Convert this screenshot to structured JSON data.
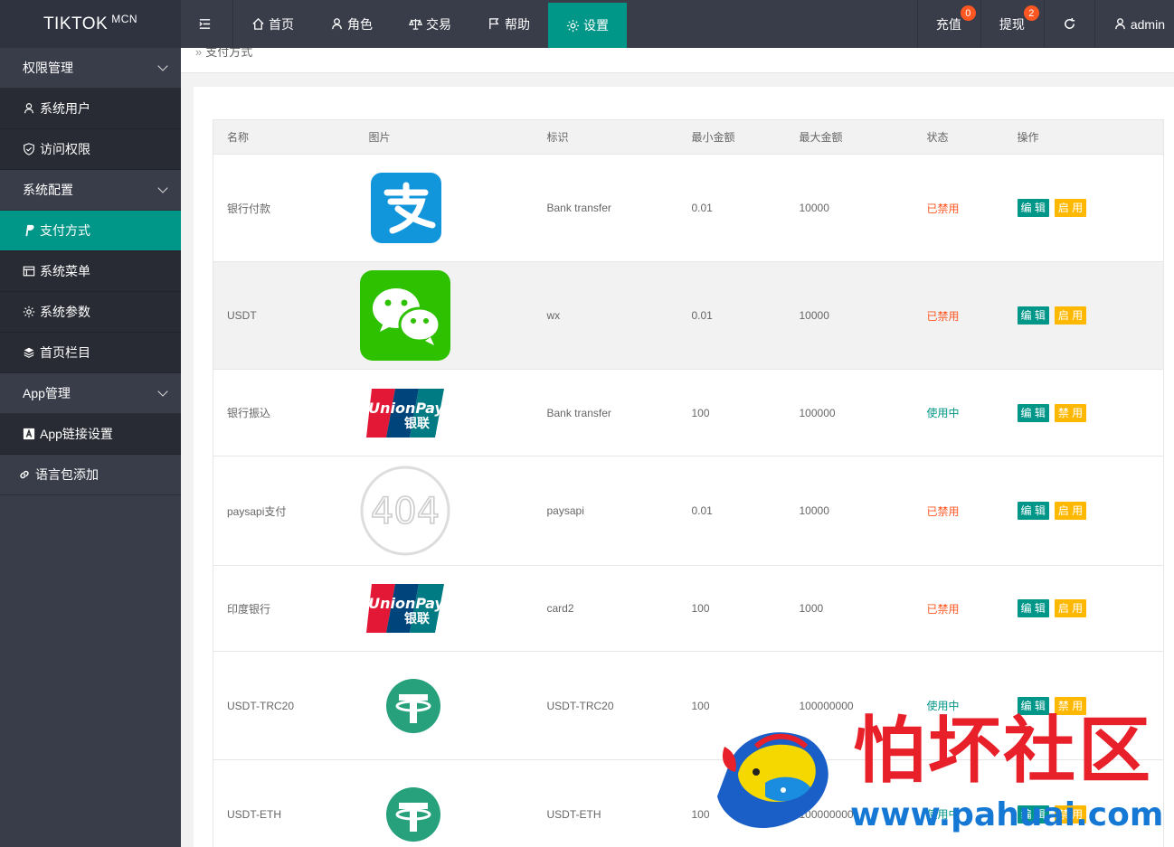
{
  "app": {
    "logo_main": "TIKTOK",
    "logo_sup": "MCN"
  },
  "header": {
    "nav": [
      {
        "label": "首页",
        "icon": "home-icon"
      },
      {
        "label": "角色",
        "icon": "user-icon"
      },
      {
        "label": "交易",
        "icon": "scale-icon"
      },
      {
        "label": "帮助",
        "icon": "flag-icon"
      },
      {
        "label": "设置",
        "icon": "gear-icon",
        "active": true
      }
    ],
    "recharge_label": "充值",
    "recharge_badge": "0",
    "withdraw_label": "提现",
    "withdraw_badge": "2",
    "admin_label": "admin"
  },
  "sidebar": {
    "group1": "权限管理",
    "item_users": "系统用户",
    "item_access": "访问权限",
    "group2": "系统配置",
    "item_payment": "支付方式",
    "item_menu": "系统菜单",
    "item_params": "系统参数",
    "item_home_columns": "首页栏目",
    "group3": "App管理",
    "item_app_link": "App链接设置",
    "item_lang": "语言包添加"
  },
  "breadcrumb": {
    "current": "支付方式"
  },
  "table": {
    "headers": {
      "name": "名称",
      "image": "图片",
      "id": "标识",
      "min": "最小金额",
      "max": "最大金额",
      "status": "状态",
      "action": "操作"
    },
    "edit_label": "编 辑",
    "rows": [
      {
        "name": "银行付款",
        "icon": "alipay-icon",
        "id": "Bank transfer",
        "min": "0.01",
        "max": "10000",
        "status": "已禁用",
        "toggle": "启 用"
      },
      {
        "name": "USDT",
        "icon": "wechat-icon",
        "id": "wx",
        "min": "0.01",
        "max": "10000",
        "status": "已禁用",
        "toggle": "启 用"
      },
      {
        "name": "银行振込",
        "icon": "unionpay-icon",
        "id": "Bank transfer",
        "min": "100",
        "max": "100000",
        "status": "使用中",
        "toggle": "禁 用"
      },
      {
        "name": "paysapi支付",
        "icon": "404-placeholder-icon",
        "id": "paysapi",
        "min": "0.01",
        "max": "10000",
        "status": "已禁用",
        "toggle": "启 用"
      },
      {
        "name": "印度银行",
        "icon": "unionpay-icon",
        "id": "card2",
        "min": "100",
        "max": "1000",
        "status": "已禁用",
        "toggle": "启 用"
      },
      {
        "name": "USDT-TRC20",
        "icon": "tether-icon",
        "id": "USDT-TRC20",
        "min": "100",
        "max": "100000000",
        "status": "使用中",
        "toggle": "禁 用"
      },
      {
        "name": "USDT-ETH",
        "icon": "tether-icon",
        "id": "USDT-ETH",
        "min": "100",
        "max": "100000000",
        "status": "使用中",
        "toggle": "禁 用"
      }
    ],
    "icon_text": {
      "unionpay_en": "UnionPay",
      "unionpay_cn": "银联",
      "placeholder": "404"
    }
  },
  "watermark": {
    "title": "怕坏社区",
    "url": "www.pahuai.com"
  },
  "colors": {
    "accent": "#009688",
    "danger": "#ff5722",
    "warn": "#ffb800",
    "nav_bg": "#393d49"
  }
}
